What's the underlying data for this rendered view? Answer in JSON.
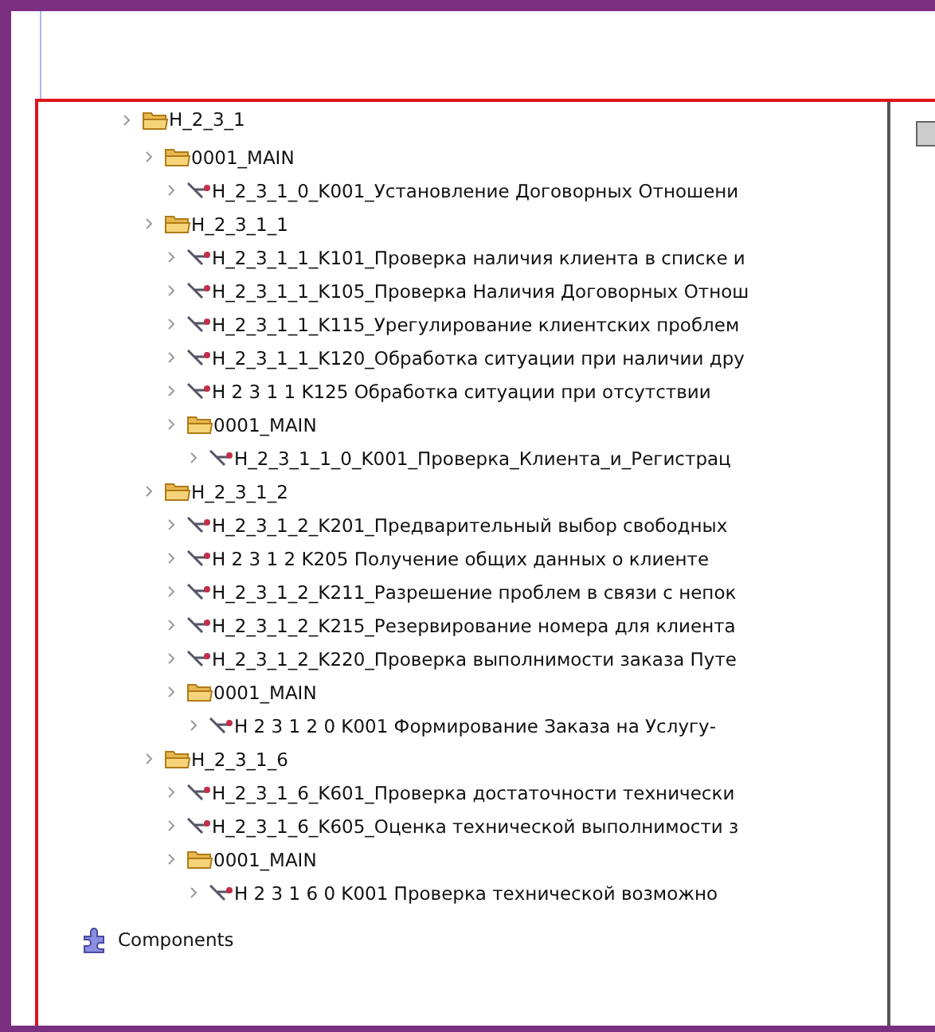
{
  "tree": [
    {
      "label": "H_2_3_1",
      "kind": "folder",
      "children": [
        {
          "label": "0001_MAIN",
          "kind": "folder",
          "children": [
            {
              "label": "H_2_3_1_0_K001_Установление Договорных Отношени",
              "kind": "process"
            }
          ]
        },
        {
          "label": "H_2_3_1_1",
          "kind": "folder",
          "children": [
            {
              "label": "H_2_3_1_1_K101_Проверка наличия клиента в списке и",
              "kind": "process"
            },
            {
              "label": "H_2_3_1_1_K105_Проверка Наличия Договорных Отнош",
              "kind": "process"
            },
            {
              "label": "H_2_3_1_1_K115_Урегулирование клиентских проблем",
              "kind": "process"
            },
            {
              "label": "H_2_3_1_1_K120_Обработка ситуации при наличии дру",
              "kind": "process"
            },
            {
              "label": "H 2 3 1 1 K125 Обработка ситуации при отсутствии",
              "kind": "process"
            },
            {
              "label": "0001_MAIN",
              "kind": "folder",
              "children": [
                {
                  "label": "H_2_3_1_1_0_K001_Проверка_Клиента_и_Регистрац",
                  "kind": "process"
                }
              ]
            }
          ]
        },
        {
          "label": "H_2_3_1_2",
          "kind": "folder",
          "children": [
            {
              "label": "H_2_3_1_2_K201_Предварительный выбор свободных",
              "kind": "process"
            },
            {
              "label": "H 2 3 1 2 K205 Получение общих данных о клиенте",
              "kind": "process"
            },
            {
              "label": "H_2_3_1_2_K211_Разрешение проблем в связи с непок",
              "kind": "process"
            },
            {
              "label": "H_2_3_1_2_K215_Резервирование номера для клиента",
              "kind": "process"
            },
            {
              "label": "H_2_3_1_2_K220_Проверка выполнимости заказа Путе",
              "kind": "process"
            },
            {
              "label": "0001_MAIN",
              "kind": "folder",
              "children": [
                {
                  "label": "H 2 3 1 2 0 K001 Формирование Заказа на Услугу-",
                  "kind": "process"
                }
              ]
            }
          ]
        },
        {
          "label": "H_2_3_1_6",
          "kind": "folder",
          "children": [
            {
              "label": "H_2_3_1_6_K601_Проверка достаточности технически",
              "kind": "process"
            },
            {
              "label": "H_2_3_1_6_K605_Оценка технической выполнимости з",
              "kind": "process"
            },
            {
              "label": "0001_MAIN",
              "kind": "folder",
              "children": [
                {
                  "label": "H 2 3 1 6 0 K001 Проверка технической возможно",
                  "kind": "process"
                }
              ]
            }
          ]
        }
      ]
    }
  ],
  "components": {
    "label": "Components"
  }
}
